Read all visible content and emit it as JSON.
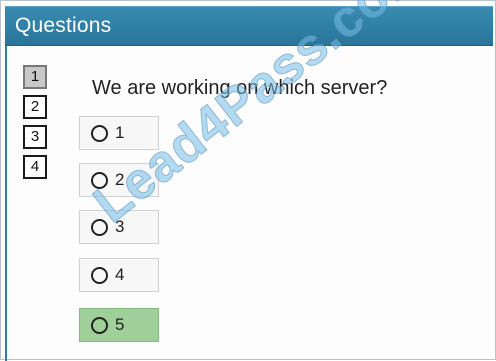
{
  "window": {
    "title": "Questions"
  },
  "nav": {
    "questions": [
      {
        "label": "1",
        "active": true
      },
      {
        "label": "2",
        "active": false
      },
      {
        "label": "3",
        "active": false
      },
      {
        "label": "4",
        "active": false
      }
    ]
  },
  "question": {
    "text": "We are working on which server?",
    "options": [
      {
        "label": "1",
        "selected": false
      },
      {
        "label": "2",
        "selected": false
      },
      {
        "label": "3",
        "selected": false
      },
      {
        "label": "4",
        "selected": false
      },
      {
        "label": "5",
        "selected": true
      }
    ]
  },
  "watermark": "Lead4Pass.com",
  "colors": {
    "titlebar": "#2f7ea4",
    "selected_option": "#9fd09a"
  }
}
